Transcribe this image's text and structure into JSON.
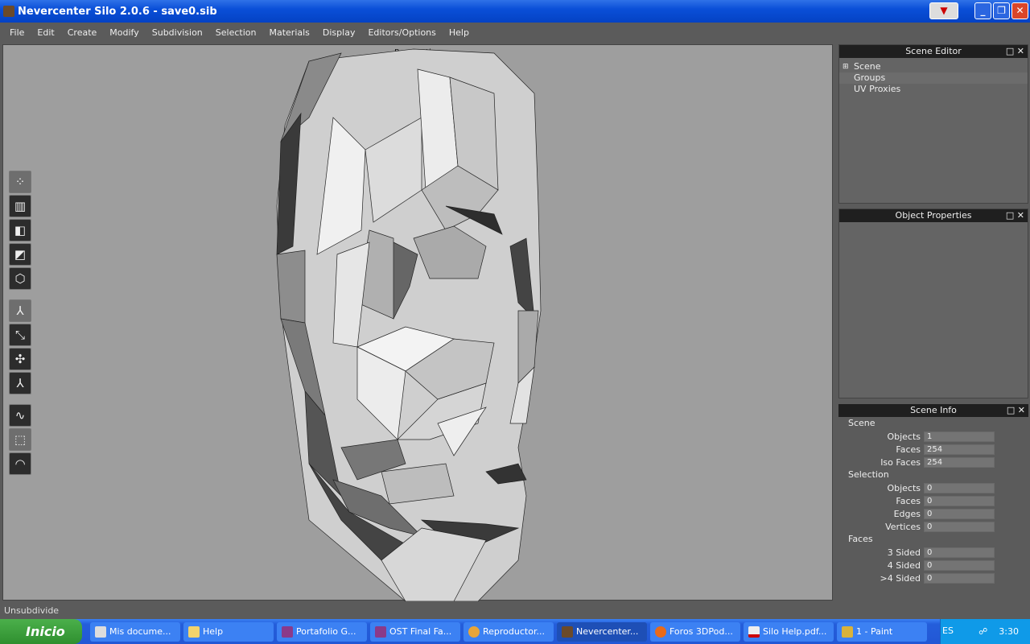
{
  "window": {
    "title": "Nevercenter Silo 2.0.6 - save0.sib"
  },
  "menu": [
    "File",
    "Edit",
    "Create",
    "Modify",
    "Subdivision",
    "Selection",
    "Materials",
    "Display",
    "Editors/Options",
    "Help"
  ],
  "viewport": {
    "label": "Perspective"
  },
  "scene_editor": {
    "title": "Scene Editor",
    "items": [
      "Scene",
      "Groups",
      "UV Proxies"
    ]
  },
  "object_properties": {
    "title": "Object Properties"
  },
  "scene_info": {
    "title": "Scene Info",
    "sections": [
      {
        "name": "Scene",
        "rows": [
          {
            "label": "Objects",
            "value": "1"
          },
          {
            "label": "Faces",
            "value": "254"
          },
          {
            "label": "Iso Faces",
            "value": "254"
          }
        ]
      },
      {
        "name": "Selection",
        "rows": [
          {
            "label": "Objects",
            "value": "0"
          },
          {
            "label": "Faces",
            "value": "0"
          },
          {
            "label": "Edges",
            "value": "0"
          },
          {
            "label": "Vertices",
            "value": "0"
          }
        ]
      },
      {
        "name": "Faces",
        "rows": [
          {
            "label": "3 Sided",
            "value": "0"
          },
          {
            "label": "4 Sided",
            "value": "0"
          },
          {
            "label": ">4 Sided",
            "value": "0"
          }
        ]
      }
    ]
  },
  "status": "Unsubdivide",
  "taskbar": {
    "start": "Inicio",
    "tasks": [
      "Mis docume...",
      "Help",
      "Portafolio G...",
      "OST Final Fa...",
      "Reproductor...",
      "Nevercenter...",
      "Foros 3DPod...",
      "Silo Help.pdf...",
      "1 - Paint"
    ],
    "lang": "ES",
    "clock": "3:30"
  }
}
